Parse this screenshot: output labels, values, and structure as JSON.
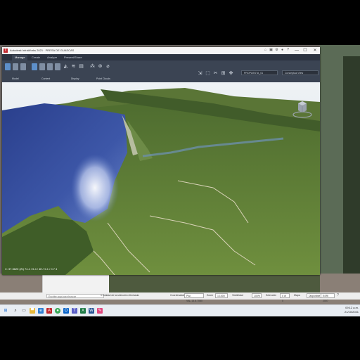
{
  "window": {
    "title": "Autodesk InfraWorks 2021 · PRESA DE GUASCAS",
    "logo_letter": "I",
    "controls": {
      "minimize": "—",
      "maximize": "☐",
      "close": "✕"
    }
  },
  "quick_access_icons": [
    "home-icon",
    "save-icon",
    "undo-icon",
    "redo-icon",
    "settings-icon",
    "user-icon",
    "help-icon"
  ],
  "tabs": [
    {
      "label": "Manage",
      "active": true
    },
    {
      "label": "Create",
      "active": false
    },
    {
      "label": "Analyze",
      "active": false
    },
    {
      "label": "Present/Share",
      "active": false
    }
  ],
  "ribbon": {
    "groups": [
      {
        "label": "Model"
      },
      {
        "label": "Content"
      },
      {
        "label": "Display"
      },
      {
        "label": "Point Clouds"
      }
    ],
    "proposal_select": "PROPUESTA_01",
    "visual_style_select": "Conceptual View"
  },
  "viewport": {
    "coordinate_readout": "X: 37.3620 (W) 74.4 / 5.4 / 4E-74.1 / 0.7 4"
  },
  "statusbar": {
    "search_placeholder": "Escribe aquí para buscar",
    "prompt": "1 entidad de la selección eliminada",
    "fields": [
      {
        "label": "Coordenadas",
        "value": "PW-VAL.13.8.7080"
      },
      {
        "label": "Zoom",
        "value": "1:1000"
      },
      {
        "label": "Visibilidad",
        "value": "100%"
      },
      {
        "label": "Selección",
        "value": "0 of 0"
      },
      {
        "label": "Mapa",
        "value": "Disponible"
      },
      {
        "label": "",
        "value": "ESRI 2007"
      }
    ]
  },
  "taskbar": {
    "icons": [
      "windows-start-icon",
      "search-icon",
      "task-view-icon",
      "explorer-icon",
      "edge-icon",
      "autodesk-icon",
      "chrome-icon",
      "outlook-icon",
      "teams-icon",
      "excel-icon",
      "word-icon",
      "paint-icon"
    ],
    "time": "09:12 a.m.",
    "date": "21/10/2021"
  }
}
